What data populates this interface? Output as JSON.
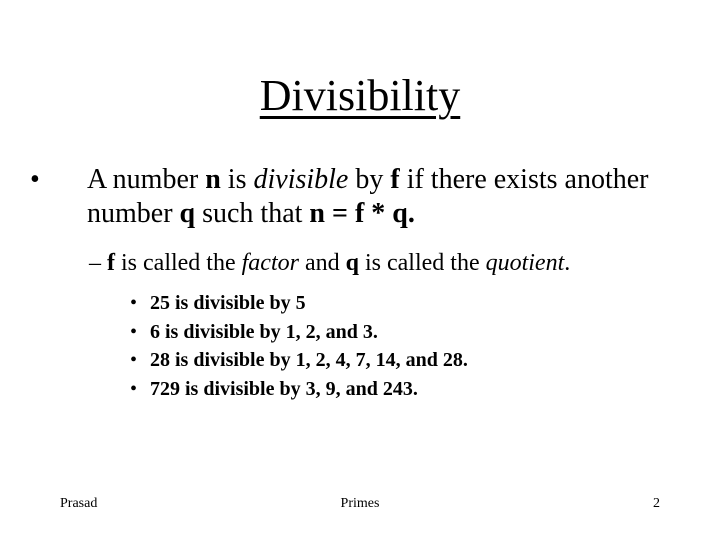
{
  "slide": {
    "title": "Divisibility",
    "bullet_glyph": "•",
    "dash_glyph": "–",
    "main_bullet": {
      "p1": "A number ",
      "n": "n",
      "p2": " is ",
      "divisible": "divisible",
      "p3": " by ",
      "f": "f",
      "p4": " if there exists another number ",
      "q": "q",
      "p5": " such that ",
      "equation": "n = f * q."
    },
    "sub_bullet": {
      "f": "f",
      "p1": " is called the ",
      "factor": "factor",
      "p2": " and ",
      "q": "q",
      "p3": " is called the ",
      "quotient": "quotient",
      "p4": "."
    },
    "examples": [
      "25 is divisible by 5",
      "6 is divisible by 1, 2, and 3.",
      "28 is divisible by 1, 2, 4, 7, 14, and 28.",
      "729 is divisible by 3, 9, and 243."
    ]
  },
  "footer": {
    "left": "Prasad",
    "center": "Primes",
    "page_number": "2"
  }
}
